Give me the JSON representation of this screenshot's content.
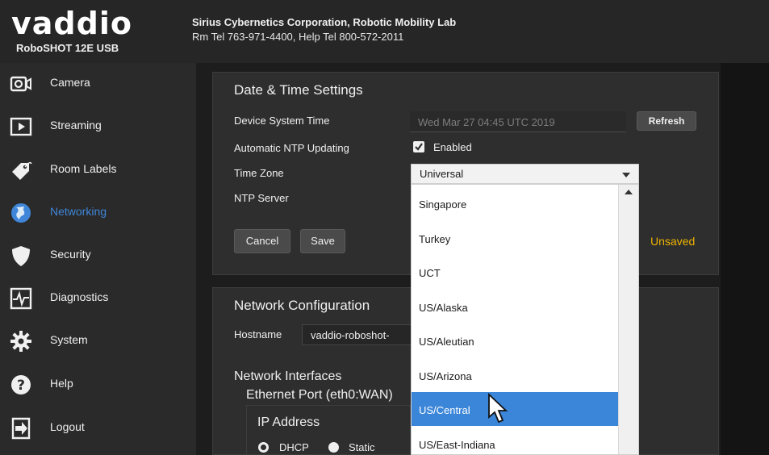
{
  "header": {
    "logo": "vaddio",
    "model": "RoboSHOT 12E USB",
    "org": "Sirius Cybernetics Corporation, Robotic Mobility Lab",
    "tel": "Rm Tel 763-971-4400, Help Tel 800-572-2011"
  },
  "sidebar": {
    "items": [
      {
        "label": "Camera",
        "icon": "camera-icon"
      },
      {
        "label": "Streaming",
        "icon": "play-icon"
      },
      {
        "label": "Room Labels",
        "icon": "tag-icon"
      },
      {
        "label": "Networking",
        "icon": "globe-icon",
        "active": true
      },
      {
        "label": "Security",
        "icon": "shield-icon"
      },
      {
        "label": "Diagnostics",
        "icon": "pulse-icon"
      },
      {
        "label": "System",
        "icon": "gear-icon"
      },
      {
        "label": "Help",
        "icon": "help-icon"
      },
      {
        "label": "Logout",
        "icon": "logout-icon"
      }
    ],
    "active_color": "#3f86d9"
  },
  "datetime": {
    "title": "Date & Time Settings",
    "device_time_label": "Device System Time",
    "device_time_value": "Wed Mar 27 04:45 UTC 2019",
    "refresh": "Refresh",
    "ntp_label": "Automatic NTP Updating",
    "ntp_enabled": "Enabled",
    "tz_label": "Time Zone",
    "tz_value": "Universal",
    "ntp_server_label": "NTP Server",
    "cancel": "Cancel",
    "save": "Save",
    "status": "Unsaved",
    "status_color": "#f0b400"
  },
  "timezone_options": [
    "Singapore",
    "Turkey",
    "UCT",
    "US/Alaska",
    "US/Aleutian",
    "US/Arizona",
    "US/Central",
    "US/East-Indiana"
  ],
  "timezone_highlight": "US/Central",
  "network": {
    "title": "Network Configuration",
    "hostname_label": "Hostname",
    "hostname_value": "vaddio-roboshot-",
    "interfaces_title": "Network Interfaces",
    "port_title": "Ethernet Port (eth0:WAN)",
    "ip_title": "IP Address",
    "dhcp": "DHCP",
    "static": "Static"
  }
}
